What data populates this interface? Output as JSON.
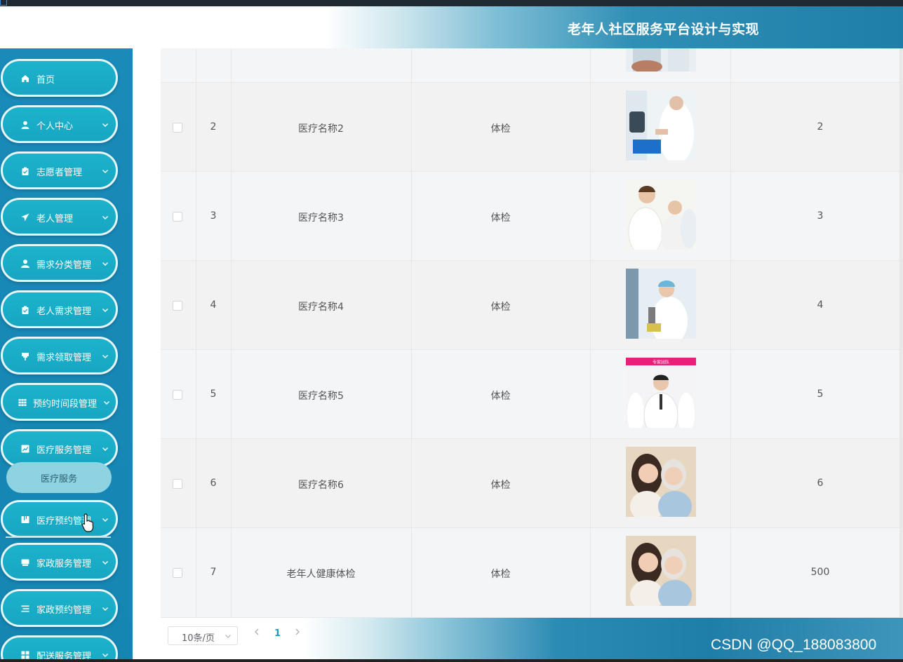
{
  "header": {
    "title": "老年人社区服务平台设计与实现"
  },
  "sidebar": {
    "items": [
      {
        "label": "首页",
        "icon": "home-icon",
        "chevron": false
      },
      {
        "label": "个人中心",
        "icon": "user-icon",
        "chevron": true
      },
      {
        "label": "志愿者管理",
        "icon": "clipboard-icon",
        "chevron": true
      },
      {
        "label": "老人管理",
        "icon": "send-icon",
        "chevron": true
      },
      {
        "label": "需求分类管理",
        "icon": "person-icon",
        "chevron": true
      },
      {
        "label": "老人需求管理",
        "icon": "clipboard-icon",
        "chevron": true
      },
      {
        "label": "需求领取管理",
        "icon": "pin-icon",
        "chevron": true
      },
      {
        "label": "预约时间段管理",
        "icon": "grid-icon",
        "chevron": true
      },
      {
        "label": "医疗服务管理",
        "icon": "chart-icon",
        "chevron": true
      },
      {
        "label": "医疗预约管理",
        "icon": "book-icon",
        "chevron": true
      },
      {
        "label": "家政服务管理",
        "icon": "tray-icon",
        "chevron": true
      },
      {
        "label": "家政预约管理",
        "icon": "list-icon",
        "chevron": true
      },
      {
        "label": "配送服务管理",
        "icon": "apps-icon",
        "chevron": true
      }
    ],
    "sub_item": {
      "label": "医疗服务"
    }
  },
  "table": {
    "rows": [
      {
        "index": "2",
        "name": "医疗名称2",
        "type": "体检",
        "value": "2",
        "photo": "lab-scientist"
      },
      {
        "index": "3",
        "name": "医疗名称3",
        "type": "体检",
        "value": "3",
        "photo": "doctors-team"
      },
      {
        "index": "4",
        "name": "医疗名称4",
        "type": "体检",
        "value": "4",
        "photo": "microscope"
      },
      {
        "index": "5",
        "name": "医疗名称5",
        "type": "体检",
        "value": "5",
        "photo": "expert-team"
      },
      {
        "index": "6",
        "name": "医疗名称6",
        "type": "体检",
        "value": "6",
        "photo": "elderly-women"
      },
      {
        "index": "7",
        "name": "老年人健康体检",
        "type": "体检",
        "value": "500",
        "photo": "elderly-women"
      }
    ],
    "expert_banner": "专家团队"
  },
  "pagination": {
    "page_size": "10条/页",
    "current_page": "1"
  },
  "watermark": "CSDN @QQ_188083800",
  "colors": {
    "accent": "#1cb3cc",
    "sidebar": "#1585b2",
    "page_active": "#1a9bb8"
  }
}
